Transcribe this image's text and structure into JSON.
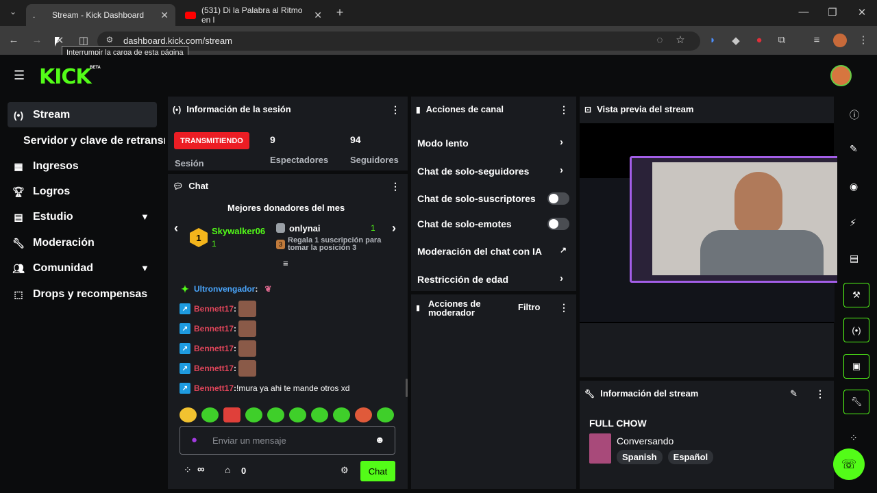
{
  "browser": {
    "tabs": [
      {
        "title": "Stream - Kick Dashboard",
        "close": "✕"
      },
      {
        "title": "(531) Di la Palabra al Ritmo en l",
        "close": "✕"
      }
    ],
    "new_tab": "+",
    "url": "dashboard.kick.com/stream",
    "tooltip": "Interrumpir la carga de esta página"
  },
  "app": {
    "logo": "KICK",
    "logo_badge": "BETA",
    "sidebar": [
      {
        "label": "Stream",
        "icon": "broadcast-icon"
      },
      {
        "label": "Servidor y clave de retransmisión",
        "icon": ""
      },
      {
        "label": "Ingresos",
        "icon": "chart-icon"
      },
      {
        "label": "Logros",
        "icon": "trophy-icon"
      },
      {
        "label": "Estudio",
        "icon": "studio-icon"
      },
      {
        "label": "Moderación",
        "icon": "wrench-icon"
      },
      {
        "label": "Comunidad",
        "icon": "community-icon"
      },
      {
        "label": "Drops y recompensas",
        "icon": "drops-icon"
      }
    ]
  },
  "session": {
    "title": "Información de la sesión",
    "status": "TRANSMITIENDO",
    "status_label": "Sesión",
    "viewers": "9",
    "viewers_label": "Espectadores",
    "followers": "94",
    "followers_label": "Seguidores"
  },
  "chat": {
    "title": "Chat",
    "top_donors_title": "Mejores donadores del mes",
    "donor1_name": "Skywalker06",
    "donor1_count": "1",
    "donor1_rank": "1",
    "donor2_name": "onlynai",
    "donor2_count": "1",
    "donor3_rank": "3",
    "donor3_text": "Regala 1 suscripción para tomar la posición 3",
    "messages": [
      {
        "user": "Ultronvengador",
        "text": ""
      },
      {
        "user": "Bennett17",
        "text": ""
      },
      {
        "user": "Bennett17",
        "text": ""
      },
      {
        "user": "Bennett17",
        "text": ""
      },
      {
        "user": "Bennett17",
        "text": ""
      },
      {
        "user": "Bennett17",
        "text": "!mura ya ahi te mande otros xd"
      }
    ],
    "colon": ":",
    "input_placeholder": "Enviar un mensaje",
    "kicks_symbol": "∞",
    "kicks_count": "0",
    "send_label": "Chat"
  },
  "channel_actions": {
    "title": "Acciones de canal",
    "items": [
      {
        "label": "Modo lento",
        "control": "arrow"
      },
      {
        "label": "Chat de solo-seguidores",
        "control": "arrow"
      },
      {
        "label": "Chat de solo-suscriptores",
        "control": "toggle",
        "on": false
      },
      {
        "label": "Chat de solo-emotes",
        "control": "toggle",
        "on": false
      },
      {
        "label": "Moderación del chat con IA",
        "control": "external"
      },
      {
        "label": "Restricción de edad",
        "control": "arrow"
      }
    ]
  },
  "mod_actions": {
    "title_line1": "Acciones de",
    "title_line2": "moderador",
    "filter": "Filtro"
  },
  "preview": {
    "title": "Vista previa del stream"
  },
  "stream_info": {
    "title": "Información del stream",
    "stream_title": "FULL CHOW",
    "category": "Conversando",
    "tags": [
      "Spanish",
      "Español"
    ]
  },
  "colors": {
    "accent": "#53fc18",
    "live": "#ec1d24",
    "panel": "#191b1f"
  }
}
